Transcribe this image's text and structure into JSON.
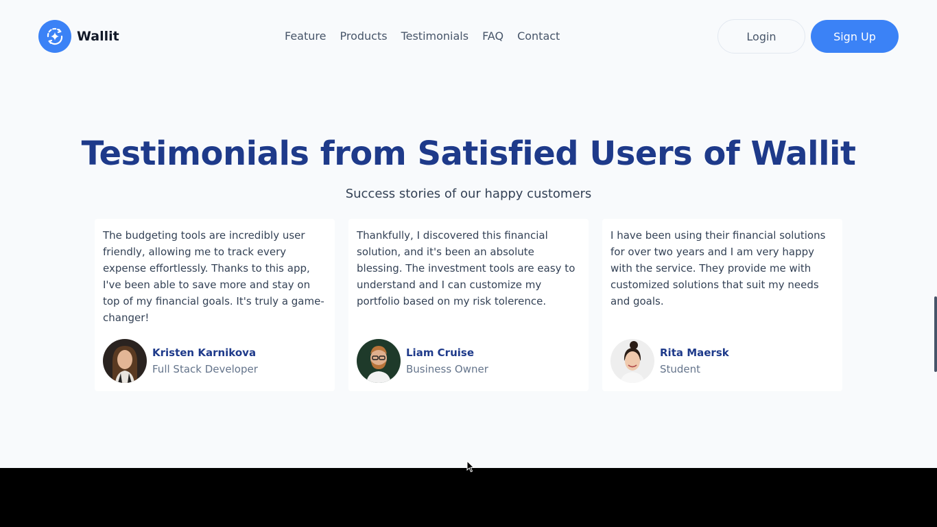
{
  "brand": {
    "name": "Wallit",
    "logo_icon": "sparkle-refresh-icon"
  },
  "nav": {
    "links": [
      {
        "label": "Feature"
      },
      {
        "label": "Products"
      },
      {
        "label": "Testimonials"
      },
      {
        "label": "FAQ"
      },
      {
        "label": "Contact"
      }
    ]
  },
  "auth": {
    "login_label": "Login",
    "signup_label": "Sign Up"
  },
  "section": {
    "title": "Testimonials from Satisfied Users of Wallit",
    "subtitle": "Success stories of our happy customers"
  },
  "testimonials": [
    {
      "quote": "The budgeting tools are incredibly user friendly, allowing me to track every expense effortlessly. Thanks to this app, I've been able to save more and stay on top of my financial goals. It's truly a game-changer!",
      "name": "Kristen Karnikova",
      "role": "Full Stack Developer"
    },
    {
      "quote": "Thankfully, I discovered this financial solution, and it's been an absolute blessing. The investment tools are easy to understand and I can customize my portfolio based on my risk tolerence.",
      "name": "Liam Cruise",
      "role": "Business Owner"
    },
    {
      "quote": "I have been using their financial solutions for over two years and I am very happy with the service. They provide me with customized solutions that suit my needs and goals.",
      "name": "Rita Maersk",
      "role": "Student"
    }
  ],
  "colors": {
    "accent": "#3b82f6",
    "heading": "#1e3a8a",
    "background": "#f8fafc"
  }
}
